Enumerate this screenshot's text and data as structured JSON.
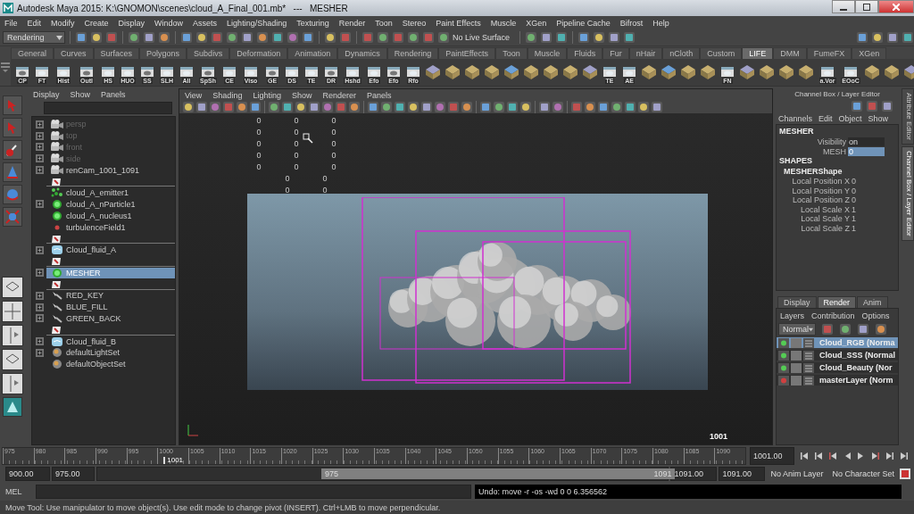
{
  "window": {
    "title": "Autodesk Maya 2015: K:\\GNOMON\\scenes\\cloud_A_Final_001.mb*   ---   MESHER"
  },
  "menu": [
    "File",
    "Edit",
    "Modify",
    "Create",
    "Display",
    "Window",
    "Assets",
    "Lighting/Shading",
    "Texturing",
    "Render",
    "Toon",
    "Stereo",
    "Paint Effects",
    "Muscle",
    "XGen",
    "Pipeline Cache",
    "Bifrost",
    "Help"
  ],
  "status_line": {
    "mode": "Rendering",
    "live_surface": "No Live Surface"
  },
  "shelf": {
    "tabs": [
      {
        "label": "General",
        "selected": false
      },
      {
        "label": "Curves",
        "selected": false
      },
      {
        "label": "Surfaces",
        "selected": false
      },
      {
        "label": "Polygons",
        "selected": false
      },
      {
        "label": "Subdivs",
        "selected": false
      },
      {
        "label": "Deformation",
        "selected": false
      },
      {
        "label": "Animation",
        "selected": false
      },
      {
        "label": "Dynamics",
        "selected": false
      },
      {
        "label": "Rendering",
        "selected": false
      },
      {
        "label": "PaintEffects",
        "selected": false
      },
      {
        "label": "Toon",
        "selected": false
      },
      {
        "label": "Muscle",
        "selected": false
      },
      {
        "label": "Fluids",
        "selected": false
      },
      {
        "label": "Fur",
        "selected": false
      },
      {
        "label": "nHair",
        "selected": false
      },
      {
        "label": "nCloth",
        "selected": false
      },
      {
        "label": "Custom",
        "selected": false
      },
      {
        "label": "LIFE",
        "selected": true
      },
      {
        "label": "DMM",
        "selected": false
      },
      {
        "label": "FumeFX",
        "selected": false
      },
      {
        "label": "XGen",
        "selected": false
      }
    ],
    "items": [
      {
        "kind": "label",
        "label": "CP"
      },
      {
        "kind": "label",
        "label": "FT"
      },
      {
        "kind": "label",
        "label": "Hist"
      },
      {
        "kind": "label",
        "label": "Outl"
      },
      {
        "kind": "label",
        "label": "HS"
      },
      {
        "kind": "label",
        "label": "HUO"
      },
      {
        "kind": "label",
        "label": "SS"
      },
      {
        "kind": "label",
        "label": "SLH"
      },
      {
        "kind": "label",
        "label": "All"
      },
      {
        "kind": "label",
        "label": "SpSh"
      },
      {
        "kind": "label",
        "label": "CE"
      },
      {
        "kind": "label",
        "label": "Viso"
      },
      {
        "kind": "label",
        "label": "GE"
      },
      {
        "kind": "label",
        "label": "DS"
      },
      {
        "kind": "label",
        "label": "TE"
      },
      {
        "kind": "label",
        "label": "DR"
      },
      {
        "kind": "label",
        "label": "Hshd"
      },
      {
        "kind": "label",
        "label": "Efo"
      },
      {
        "kind": "label",
        "label": "Efo"
      },
      {
        "kind": "label",
        "label": "Rfo"
      },
      {
        "kind": "icon"
      },
      {
        "kind": "icon"
      },
      {
        "kind": "icon"
      },
      {
        "kind": "icon"
      },
      {
        "kind": "icon"
      },
      {
        "kind": "icon"
      },
      {
        "kind": "icon"
      },
      {
        "kind": "icon"
      },
      {
        "kind": "icon"
      },
      {
        "kind": "label",
        "label": "TE"
      },
      {
        "kind": "label",
        "label": "AE"
      },
      {
        "kind": "icon"
      },
      {
        "kind": "icon"
      },
      {
        "kind": "icon"
      },
      {
        "kind": "icon"
      },
      {
        "kind": "label",
        "label": "FN"
      },
      {
        "kind": "icon"
      },
      {
        "kind": "icon"
      },
      {
        "kind": "icon"
      },
      {
        "kind": "icon"
      },
      {
        "kind": "label",
        "label": "a.Vor"
      },
      {
        "kind": "label",
        "label": "EOoC"
      },
      {
        "kind": "icon"
      },
      {
        "kind": "icon"
      },
      {
        "kind": "icon"
      }
    ]
  },
  "outliner": {
    "menu": [
      "Display",
      "Show",
      "Panels"
    ],
    "items": [
      {
        "kind": "camera",
        "label": "persp",
        "expandable": true,
        "dimmed": true,
        "selected": false
      },
      {
        "kind": "camera",
        "label": "top",
        "expandable": true,
        "dimmed": true,
        "selected": false
      },
      {
        "kind": "camera",
        "label": "front",
        "expandable": true,
        "dimmed": true,
        "selected": false
      },
      {
        "kind": "camera",
        "label": "side",
        "expandable": true,
        "dimmed": true,
        "selected": false
      },
      {
        "kind": "camera",
        "label": "renCam_1001_1091",
        "expandable": true,
        "dimmed": false,
        "selected": false
      },
      {
        "kind": "divider",
        "expandable": false,
        "selected": false
      },
      {
        "kind": "emitter",
        "label": "cloud_A_emitter1",
        "expandable": false,
        "dimmed": false,
        "selected": false
      },
      {
        "kind": "particle",
        "label": "cloud_A_nParticle1",
        "expandable": true,
        "dimmed": false,
        "selected": false
      },
      {
        "kind": "particle",
        "label": "cloud_A_nucleus1",
        "expandable": false,
        "dimmed": false,
        "selected": false
      },
      {
        "kind": "field",
        "label": "turbulenceField1",
        "expandable": false,
        "dimmed": false,
        "selected": false
      },
      {
        "kind": "divider",
        "expandable": false,
        "selected": false
      },
      {
        "kind": "fluid",
        "label": "Cloud_fluid_A",
        "expandable": true,
        "dimmed": false,
        "selected": false
      },
      {
        "kind": "divider",
        "expandable": false,
        "selected": false
      },
      {
        "kind": "particle",
        "label": "MESHER",
        "expandable": true,
        "dimmed": false,
        "selected": true
      },
      {
        "kind": "divider",
        "expandable": false,
        "selected": false
      },
      {
        "kind": "light",
        "label": "RED_KEY",
        "expandable": true,
        "dimmed": false,
        "selected": false
      },
      {
        "kind": "light",
        "label": "BLUE_FILL",
        "expandable": true,
        "dimmed": false,
        "selected": false
      },
      {
        "kind": "light",
        "label": "GREEN_BACK",
        "expandable": true,
        "dimmed": false,
        "selected": false
      },
      {
        "kind": "divider",
        "expandable": false,
        "selected": false
      },
      {
        "kind": "fluid",
        "label": "Cloud_fluid_B",
        "expandable": true,
        "dimmed": false,
        "selected": false
      },
      {
        "kind": "set",
        "label": "defaultLightSet",
        "expandable": true,
        "dimmed": false,
        "selected": false
      },
      {
        "kind": "set",
        "label": "defaultObjectSet",
        "expandable": false,
        "dimmed": false,
        "selected": false
      }
    ]
  },
  "viewport": {
    "menu": [
      "View",
      "Shading",
      "Lighting",
      "Show",
      "Renderer",
      "Panels"
    ],
    "hud": [
      {
        "values": [
          "0",
          "0",
          "0"
        ]
      },
      {
        "values": [
          "0",
          "0",
          "0"
        ]
      },
      {
        "values": [
          "0",
          "0",
          "0"
        ]
      },
      {
        "values": [
          "0",
          "0",
          "0"
        ]
      },
      {
        "values": [
          "0",
          "0",
          "0"
        ]
      },
      {
        "values": [
          "0",
          "0"
        ]
      },
      {
        "values": [
          "0",
          "0"
        ]
      }
    ],
    "frame_counter": "1001"
  },
  "channel_box": {
    "title": "Channel Box / Layer Editor",
    "menu": [
      "Channels",
      "Edit",
      "Object",
      "Show"
    ],
    "node": "MESHER",
    "channels": [
      {
        "label": "Visibility",
        "value": "on",
        "selected": false
      },
      {
        "label": "MESH",
        "value": "0",
        "selected": true
      }
    ],
    "shapes_heading": "SHAPES",
    "shape": "MESHERShape",
    "shape_channels": [
      {
        "label": "Local Position X",
        "value": "0"
      },
      {
        "label": "Local Position Y",
        "value": "0"
      },
      {
        "label": "Local Position Z",
        "value": "0"
      },
      {
        "label": "Local Scale X",
        "value": "1"
      },
      {
        "label": "Local Scale Y",
        "value": "1"
      },
      {
        "label": "Local Scale Z",
        "value": "1"
      }
    ]
  },
  "layer_editor": {
    "tabs": [
      {
        "label": "Display",
        "selected": false
      },
      {
        "label": "Render",
        "selected": true
      },
      {
        "label": "Anim",
        "selected": false
      }
    ],
    "menu": [
      "Layers",
      "Contribution",
      "Options"
    ],
    "mode": "Normal",
    "layers": [
      {
        "label": "Cloud_RGB (Norma",
        "selected": true,
        "master": false
      },
      {
        "label": "Cloud_SSS (Normal",
        "selected": false,
        "master": false
      },
      {
        "label": "Cloud_Beauty (Nor",
        "selected": false,
        "master": false
      },
      {
        "label": "masterLayer (Norm",
        "selected": false,
        "master": true
      }
    ]
  },
  "side_tabs": [
    {
      "label": "Attribute Editor",
      "selected": false
    },
    {
      "label": "Channel Box / Layer Editor",
      "selected": true
    }
  ],
  "timeline": {
    "ticks": [
      "975",
      "980",
      "985",
      "990",
      "995",
      "1000",
      "1005",
      "1010",
      "1015",
      "1020",
      "1025",
      "1030",
      "1035",
      "1040",
      "1045",
      "1050",
      "1055",
      "1060",
      "1065",
      "1070",
      "1075",
      "1080",
      "1085",
      "1090"
    ],
    "current": "1001",
    "current_field": "1001.00"
  },
  "range": {
    "start": "900.00",
    "playback_start": "975.00",
    "slider_start": "975",
    "slider_end": "1091",
    "playback_end": "1091.00",
    "end": "1091.00",
    "anim_layer": "No Anim Layer",
    "character_set": "No Character Set"
  },
  "command_line": {
    "label": "MEL",
    "result": "Undo: move -r -os -wd 0 0 6.356562"
  },
  "help_line": "Move Tool: Use manipulator to move object(s). Use edit mode to change pivot (INSERT). Ctrl+LMB to move perpendicular."
}
